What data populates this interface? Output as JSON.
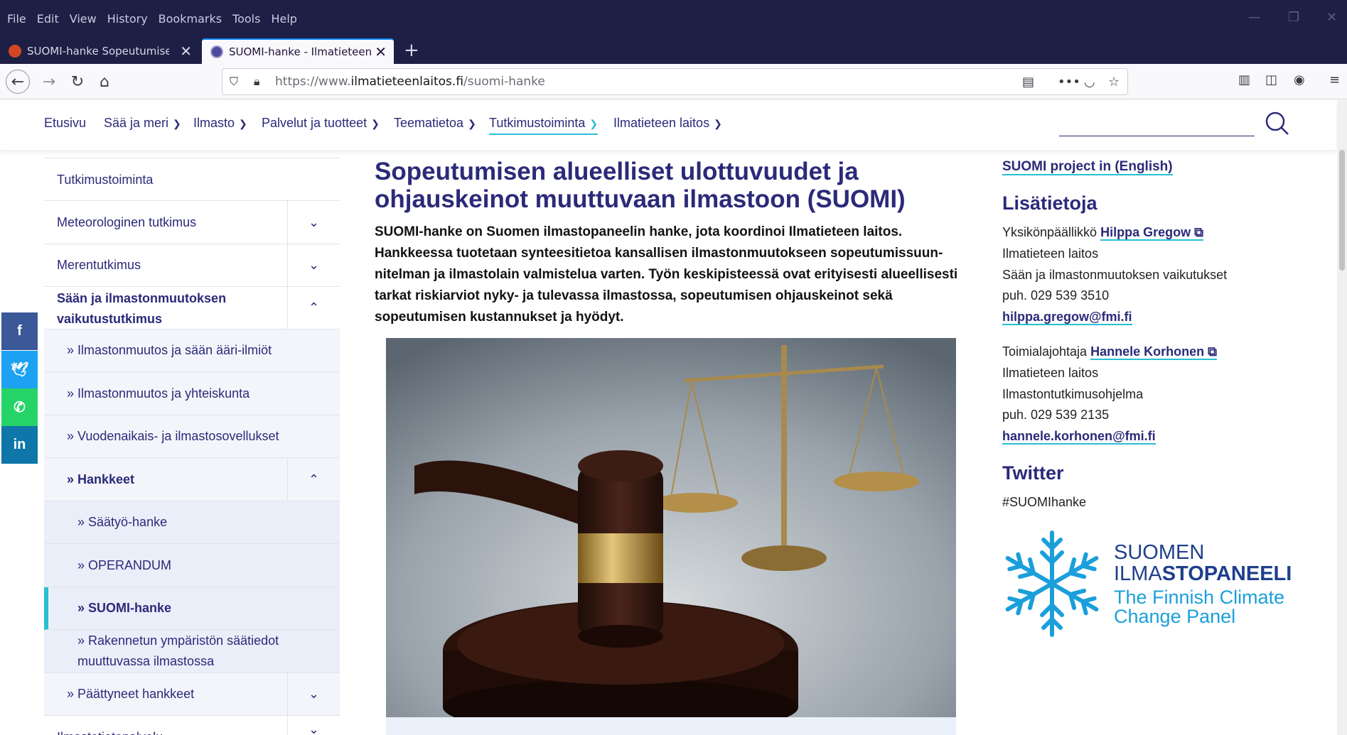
{
  "browser": {
    "menu": [
      "File",
      "Edit",
      "View",
      "History",
      "Bookmarks",
      "Tools",
      "Help"
    ],
    "tabs": [
      {
        "title": "SUOMI-hanke Sopeutumisen sä",
        "active": false
      },
      {
        "title": "SUOMI-hanke - Ilmatieteen lait",
        "active": true
      }
    ],
    "url_prefix": "https://www.",
    "url_domain": "ilmatieteenlaitos.fi",
    "url_path": "/suomi-hanke"
  },
  "sitenav": {
    "items": [
      "Etusivu",
      "Sää ja meri",
      "Ilmasto",
      "Palvelut ja tuotteet",
      "Teematietoa",
      "Tutkimustoiminta",
      "Ilmatieteen laitos"
    ],
    "active": "Tutkimustoiminta"
  },
  "social": [
    "f",
    "t",
    "w",
    "in"
  ],
  "sidemenu": {
    "items": [
      {
        "label": "Tutkimustoiminta"
      },
      {
        "label": "Meteorologinen tutkimus"
      },
      {
        "label": "Merentutkimus"
      },
      {
        "label": "Sään ja ilmastonmuutoksen vaikutustutkimus"
      },
      {
        "label": "» Ilmastonmuutos ja sään ääri-ilmiöt"
      },
      {
        "label": "» Ilmastonmuutos ja yhteiskunta"
      },
      {
        "label": "» Vuodenaikais- ja ilmastosovellukset"
      },
      {
        "label": "» Hankkeet"
      },
      {
        "label": "» Säätyö-hanke"
      },
      {
        "label": "» OPERANDUM"
      },
      {
        "label": "» SUOMI-hanke"
      },
      {
        "label": "» Rakennetun ympäristön säätiedot muuttuvassa ilmastossa"
      },
      {
        "label": "» Päättyneet hankkeet"
      },
      {
        "label": "Ilmastotietopalvelu"
      }
    ]
  },
  "main": {
    "title": "Sopeutumisen alueelliset ulottuvuudet ja ohjauskeinot muuttuvaan ilmastoon (SUOMI)",
    "lead": "SUOMI-hanke on Suomen ilmastopaneelin hanke, jota koordinoi Ilmatieteen laitos. Hankkeessa tuotetaan synteesitietoa kansallisen ilmastonmuutokseen sopeutumissuun­nitelman ja ilmastolain valmistelua varten. Työn keskipisteessä ovat erityisesti alueelli­sesti tarkat riskiarviot nyky- ja tulevassa ilmastossa, sopeutumisen ohjauskeinot sekä sopeutumisen kustannukset ja hyödyt."
  },
  "aside": {
    "english_link": "SUOMI project in (English)",
    "info_heading": "Lisätietoja",
    "contact1": {
      "role": "Yksikönpäällikkö",
      "name": "Hilppa Gregow",
      "org": "Ilmatieteen laitos",
      "unit": "Sään ja ilmastonmuutoksen vaikutukset",
      "phone": "puh. 029 539 3510",
      "email": "hilppa.gregow@fmi.fi"
    },
    "contact2": {
      "role": "Toimialajohtaja",
      "name": "Hannele Korhonen",
      "org": "Ilmatieteen laitos",
      "unit": "Ilmastontutkimusohjelma",
      "phone": "puh. 029 539 2135",
      "email": "hannele.korhonen@fmi.fi"
    },
    "twitter_heading": "Twitter",
    "hashtag": "#SUOMIhanke",
    "logo": {
      "line1": "SUOMEN",
      "line2a": "ILMA",
      "line2b": "STOPANEELI",
      "line3": "The Finnish Climate",
      "line4": "Change Panel"
    }
  },
  "colors": {
    "brand": "#2b2a79",
    "accent": "#27bfd3",
    "logo": "#1a9fdb"
  }
}
